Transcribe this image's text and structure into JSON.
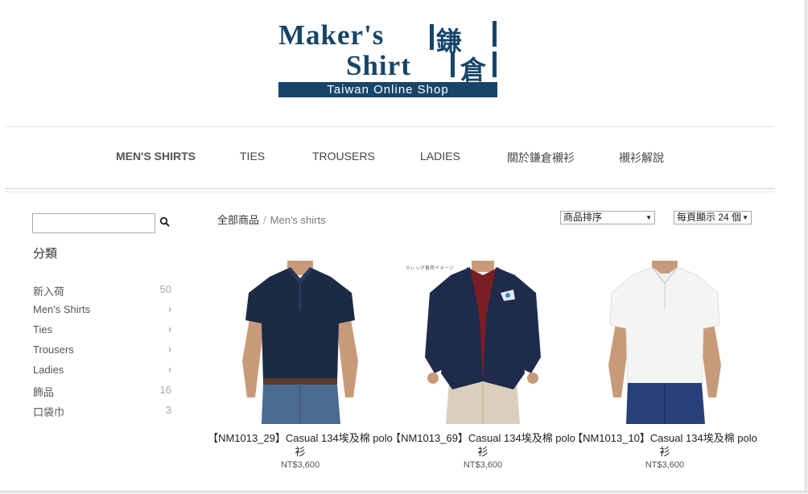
{
  "logo": {
    "line1": "Maker's",
    "line2": "Shirt",
    "kanji1": "鎌",
    "kanji2": "倉",
    "tagline": "Taiwan Online Shop"
  },
  "nav": {
    "items": [
      "MEN'S SHIRTS",
      "TIES",
      "TROUSERS",
      "LADIES",
      "關於鎌倉襯衫",
      "襯衫解說"
    ],
    "active": "MEN'S SHIRTS"
  },
  "sidebar": {
    "search_value": "",
    "search_icon": "search-icon",
    "category_title": "分類",
    "categories": [
      {
        "label": "新入荷",
        "count": "50"
      },
      {
        "label": "Men's Shirts",
        "count": ""
      },
      {
        "label": "Ties",
        "count": ""
      },
      {
        "label": "Trousers",
        "count": ""
      },
      {
        "label": "Ladies",
        "count": ""
      },
      {
        "label": "飾品",
        "count": "16"
      },
      {
        "label": "口袋巾",
        "count": "3"
      }
    ]
  },
  "breadcrumb": {
    "root": "全部商品",
    "separator": "/",
    "current": "Men's shirts"
  },
  "controls": {
    "sort_label": "商品排序",
    "per_page_label": "每頁顯示 24 個"
  },
  "products": [
    {
      "name": "【NM1013_29】Casual 134埃及棉 polo衫",
      "price": "NT$3,600",
      "shirt_color": "#1c2a45",
      "pants_color": "#4a6a92"
    },
    {
      "name": "【NM1013_69】Casual 134埃及棉 polo衫",
      "price": "NT$3,600",
      "shirt_color": "#7a1e24",
      "jacket_color": "#1f2b4a",
      "pants_color": "#d9cfbc",
      "note": "※レッグ着用イメージ"
    },
    {
      "name": "【NM1013_10】Casual 134埃及棉 polo衫",
      "price": "NT$3,600",
      "shirt_color": "#f4f4f2",
      "pants_color": "#27407a"
    }
  ],
  "colors": {
    "brand": "#17456a"
  }
}
